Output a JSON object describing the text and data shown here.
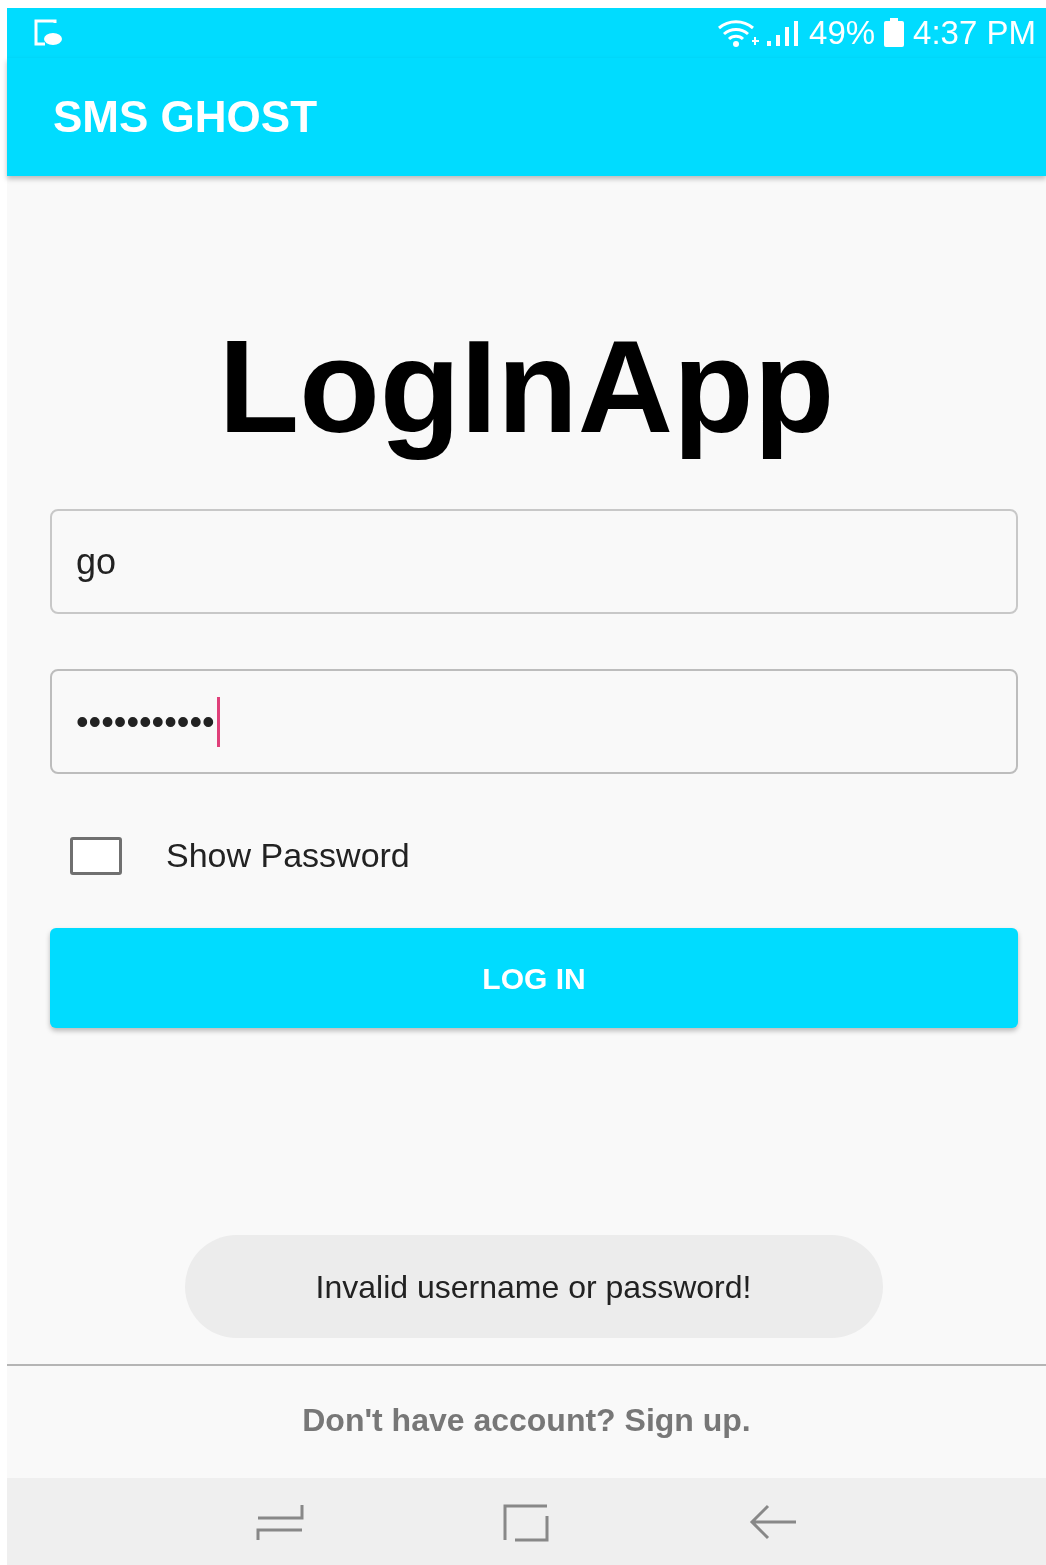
{
  "status_bar": {
    "battery": "49%",
    "time": "4:37 PM"
  },
  "app_bar": {
    "title": "SMS GHOST"
  },
  "heading": "LogInApp",
  "username": {
    "value": "go",
    "focused": false
  },
  "password": {
    "value": "•••••••••••",
    "focused": true
  },
  "show_password": {
    "label": "Show Password",
    "checked": false
  },
  "login_button": "LOG IN",
  "toast": "Invalid username or password!",
  "signup_link": "Don't have account? Sign up."
}
